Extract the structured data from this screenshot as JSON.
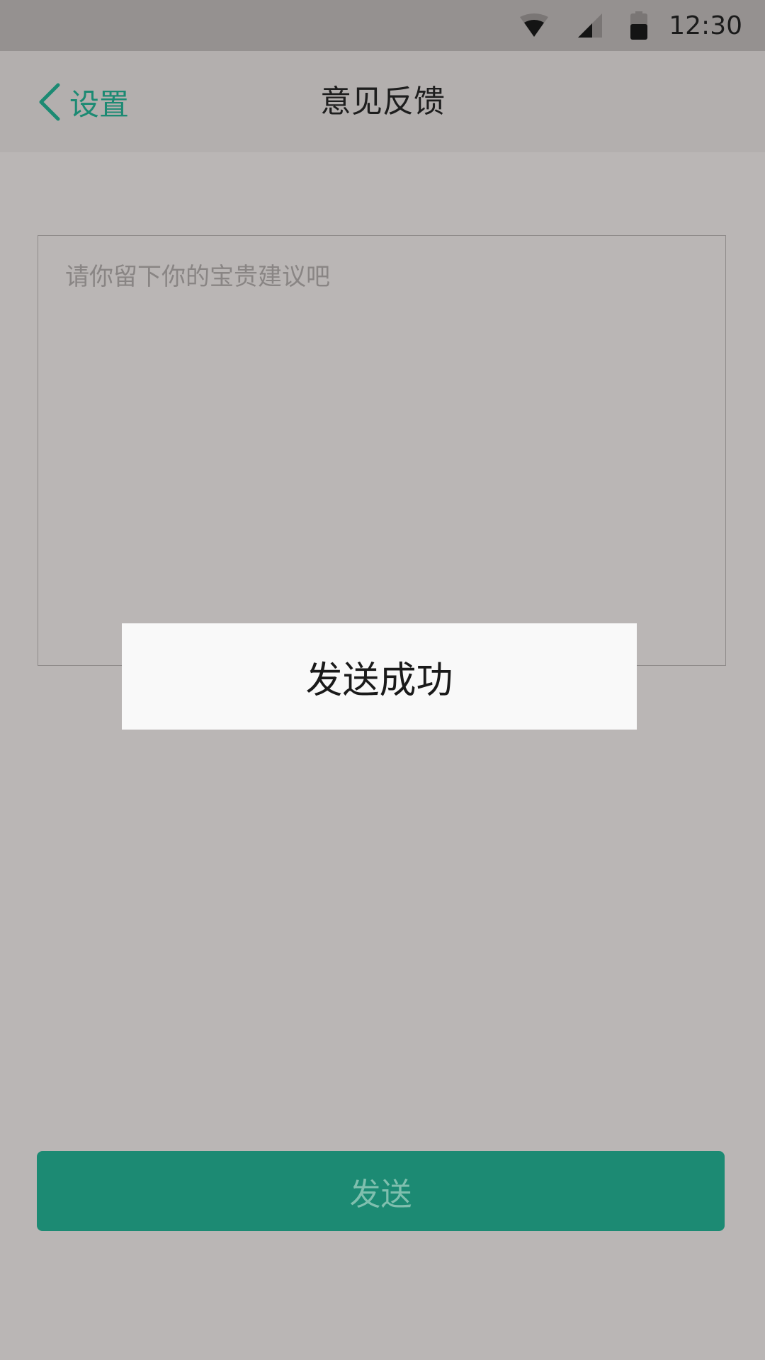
{
  "status_bar": {
    "time": "12:30",
    "icons": [
      "wifi-icon",
      "signal-icon",
      "battery-icon"
    ]
  },
  "nav": {
    "back_label": "设置",
    "title": "意见反馈"
  },
  "feedback": {
    "placeholder": "请你留下你的宝贵建议吧",
    "value": ""
  },
  "toast": {
    "message": "发送成功"
  },
  "send_button": {
    "label": "发送"
  },
  "colors": {
    "accent": "#1c8a73",
    "background": "#bab6b5",
    "status_bar": "#959190",
    "nav_bar": "#b3afae",
    "toast_bg": "#f9f9f9"
  }
}
